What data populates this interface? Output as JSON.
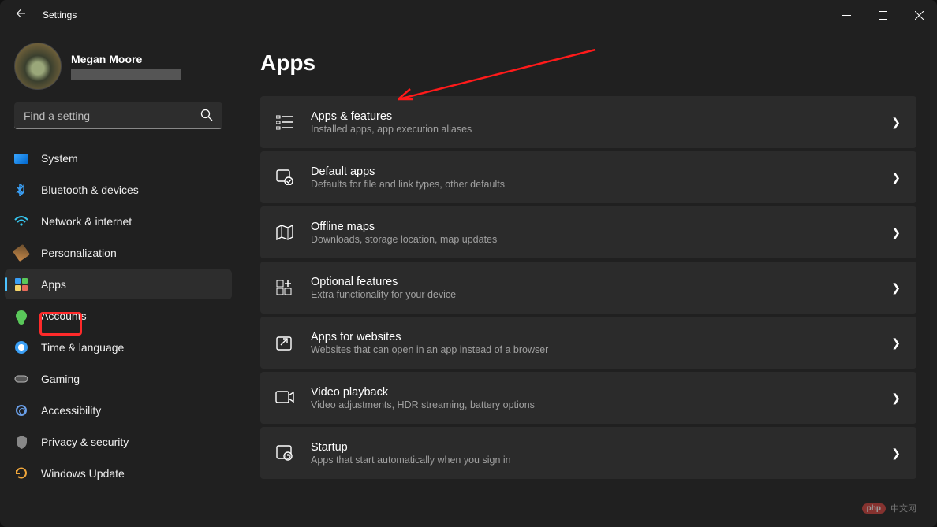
{
  "titlebar": {
    "title": "Settings"
  },
  "user": {
    "name": "Megan Moore"
  },
  "search": {
    "placeholder": "Find a setting"
  },
  "sidebar": {
    "items": [
      {
        "label": "System"
      },
      {
        "label": "Bluetooth & devices"
      },
      {
        "label": "Network & internet"
      },
      {
        "label": "Personalization"
      },
      {
        "label": "Apps"
      },
      {
        "label": "Accounts"
      },
      {
        "label": "Time & language"
      },
      {
        "label": "Gaming"
      },
      {
        "label": "Accessibility"
      },
      {
        "label": "Privacy & security"
      },
      {
        "label": "Windows Update"
      }
    ]
  },
  "page": {
    "title": "Apps"
  },
  "cards": [
    {
      "title": "Apps & features",
      "sub": "Installed apps, app execution aliases"
    },
    {
      "title": "Default apps",
      "sub": "Defaults for file and link types, other defaults"
    },
    {
      "title": "Offline maps",
      "sub": "Downloads, storage location, map updates"
    },
    {
      "title": "Optional features",
      "sub": "Extra functionality for your device"
    },
    {
      "title": "Apps for websites",
      "sub": "Websites that can open in an app instead of a browser"
    },
    {
      "title": "Video playback",
      "sub": "Video adjustments, HDR streaming, battery options"
    },
    {
      "title": "Startup",
      "sub": "Apps that start automatically when you sign in"
    }
  ],
  "watermark": {
    "logo": "php",
    "text": "中文网"
  }
}
